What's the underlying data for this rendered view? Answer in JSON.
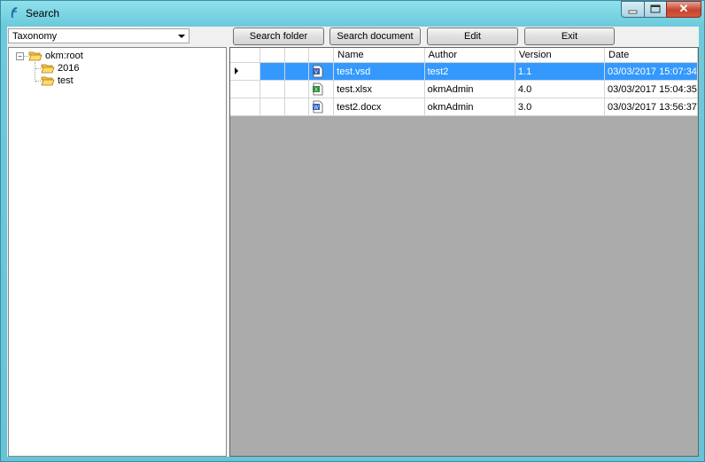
{
  "window": {
    "title": "Search",
    "close_glyph": "✕"
  },
  "toolbar": {
    "taxonomy_value": "Taxonomy",
    "search_folder_label": "Search folder",
    "search_document_label": "Search document",
    "edit_label": "Edit",
    "exit_label": "Exit"
  },
  "tree": {
    "root_label": "okm:root",
    "children": [
      "2016",
      "test"
    ]
  },
  "grid": {
    "columns": [
      "Name",
      "Author",
      "Version",
      "Date"
    ],
    "rows": [
      {
        "icon": "visio-doc-icon",
        "name": "test.vsd",
        "author": "test2",
        "version": "1.1",
        "date": "03/03/2017 15:07:34",
        "selected": true
      },
      {
        "icon": "excel-doc-icon",
        "name": "test.xlsx",
        "author": "okmAdmin",
        "version": "4.0",
        "date": "03/03/2017 15:04:35",
        "selected": false
      },
      {
        "icon": "word-doc-icon",
        "name": "test2.docx",
        "author": "okmAdmin",
        "version": "3.0",
        "date": "03/03/2017 13:56:37",
        "selected": false
      }
    ]
  },
  "colors": {
    "selection": "#3399ff",
    "grid_background": "#ababab",
    "title_gradient": "#6ccadb"
  }
}
